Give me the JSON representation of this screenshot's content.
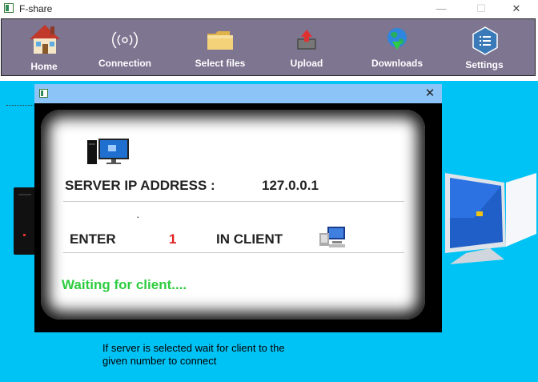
{
  "window": {
    "title": "F-share",
    "minimize": "—",
    "maximize": "☐",
    "close": "✕"
  },
  "toolbar": {
    "home": "Home",
    "connection": "Connection",
    "select_files": "Select files",
    "upload": "Upload",
    "downloads": "Downloads",
    "settings": "Settings"
  },
  "dialog": {
    "close": "✕",
    "server_ip_label": "SERVER IP ADDRESS :",
    "server_ip_value": "127.0.0.1",
    "enter_label": "ENTER",
    "enter_number": "1",
    "in_client_label": "IN CLIENT",
    "waiting_text": "Waiting for client....",
    "dot": "."
  },
  "info": {
    "line1": "If server is selected wait for client to the",
    "line2": "given number to connect"
  },
  "colors": {
    "toolbar_bg": "#7e7591",
    "content_bg": "#00c3f5",
    "dialog_title_bg": "#8cc4f8",
    "number_color": "#e02020",
    "waiting_color": "#2ecc40"
  }
}
